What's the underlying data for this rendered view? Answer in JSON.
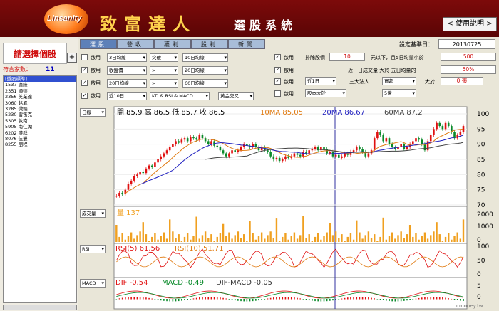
{
  "header": {
    "logo_text": "Linsanity",
    "title": "致富達人",
    "subtitle": "選股系統",
    "help_button": "< 使用說明 >"
  },
  "left": {
    "select_title": "請選擇個股",
    "plus": "+",
    "count_label": "符合家數：",
    "count_value": "11",
    "stocks": [
      "[選股標準]",
      "1537 廣隆",
      "2351 順德",
      "2356 英業達",
      "3060 銘異",
      "3285 微端",
      "5230 雷笛克",
      "5305 敦南",
      "5905 南仁湖",
      "6202 盛群",
      "8076 伍豐",
      "8255 朋程"
    ]
  },
  "tabs": [
    "選股",
    "營收",
    "獲利",
    "股利",
    "新聞"
  ],
  "date": {
    "label": "設定基準日：",
    "value": "20130725"
  },
  "conditions": [
    {
      "checked": false,
      "label": "啟用",
      "period": "3日均線",
      "rel": "突破",
      "target": "10日均線"
    },
    {
      "checked": true,
      "label": "啟用",
      "period": "收盤價",
      "rel": ">",
      "target": "20日均線"
    },
    {
      "checked": true,
      "label": "啟用",
      "period": "20日均線",
      "rel": ">",
      "target": "60日均線"
    },
    {
      "checked": true,
      "label": "啟用",
      "period": "近10日",
      "rel": "KD & RSI & MACD",
      "target": "黃金交叉"
    }
  ],
  "right_conditions": {
    "r1": {
      "checked": true,
      "label": "啟用",
      "text1": "排除股價",
      "value": "10",
      "text2": "元以下，且5日均量小於",
      "value2": "500"
    },
    "r2": {
      "checked": true,
      "label": "啟用",
      "text1": "近一日成交量 大於 五日均量的",
      "value2": "50%"
    },
    "r3": {
      "checked": true,
      "label": "啟用",
      "sel1": "近1日",
      "text1": "三大法人",
      "sel2": "買超",
      "text2": "大於",
      "value2": "0",
      "unit": "張"
    },
    "r4": {
      "checked": false,
      "label": "啟用",
      "sel1": "股本大於",
      "sel2": "5億"
    }
  },
  "chart_panel": {
    "period_select": "日線",
    "volume_select": "成交量",
    "rsi_select": "RSI",
    "macd_select": "MACD",
    "ohlc": {
      "open_label": "開",
      "open": "85.9",
      "high_label": "高",
      "high": "86.5",
      "low_label": "低",
      "low": "85.7",
      "close_label": "收",
      "close": "86.5"
    },
    "ma_labels": [
      {
        "name": "10MA",
        "value": "85.05",
        "color": "#e07a10"
      },
      {
        "name": "20MA",
        "value": "86.67",
        "color": "#2020c0"
      },
      {
        "name": "60MA",
        "value": "87.2",
        "color": "#404040"
      }
    ],
    "volume_label": "量 137",
    "rsi_label": {
      "a": "RSI(5) 61.56",
      "b": "RSI(10) 51.71"
    },
    "macd_label": {
      "dif": "DIF -0.54",
      "macd": "MACD -0.49",
      "diff": "DIF-MACD -0.05"
    },
    "price_ticks": [
      "100",
      "95",
      "90",
      "85",
      "80",
      "75",
      "70"
    ],
    "volume_ticks": [
      "2000",
      "1000",
      "0"
    ],
    "rsi_ticks": [
      "100",
      "50",
      "0"
    ],
    "macd_ticks": [
      "5",
      "0"
    ],
    "colors": {
      "up": "#e01010",
      "down": "#0a8a2a",
      "ma10": "#e07a10",
      "ma20": "#2020c0",
      "ma60": "#404040",
      "vol": "#f0a020"
    }
  },
  "watermark": "cmoney.tw",
  "chart_data": {
    "type": "candlestick",
    "ylim": [
      70,
      100
    ],
    "closes": [
      73,
      74,
      73.5,
      75,
      77,
      78,
      79.5,
      80,
      81,
      80.5,
      82,
      83,
      82.5,
      84,
      85,
      86,
      87,
      88,
      89,
      90,
      91,
      90.5,
      91.5,
      92,
      91,
      92.5,
      92,
      91.5,
      93,
      92,
      91,
      90,
      91,
      89.5,
      89,
      88,
      87,
      86,
      87,
      88,
      87.5,
      88,
      89,
      90,
      89.5,
      89,
      90,
      89,
      88,
      89,
      88,
      87.5,
      86,
      85,
      85.5,
      84.5,
      85,
      86,
      85.5,
      86,
      87,
      86.5,
      86,
      87.5,
      87,
      88,
      88.5,
      89,
      88,
      89,
      88.5,
      87,
      87.5,
      86,
      86.5,
      85.5,
      86,
      87,
      86.5,
      87.5,
      88,
      89,
      88.5,
      87.5,
      86,
      87,
      88,
      92,
      94,
      93,
      91,
      92,
      90,
      89,
      88.5,
      89,
      90,
      88.5,
      89,
      90,
      91,
      92,
      91.5,
      90,
      88,
      91,
      93,
      95,
      97,
      96,
      95,
      97,
      96,
      94,
      92,
      93,
      94,
      96
    ],
    "volume_peak": 2000,
    "rsi_range": [
      0,
      100
    ],
    "macd_range": [
      -5,
      5
    ]
  }
}
